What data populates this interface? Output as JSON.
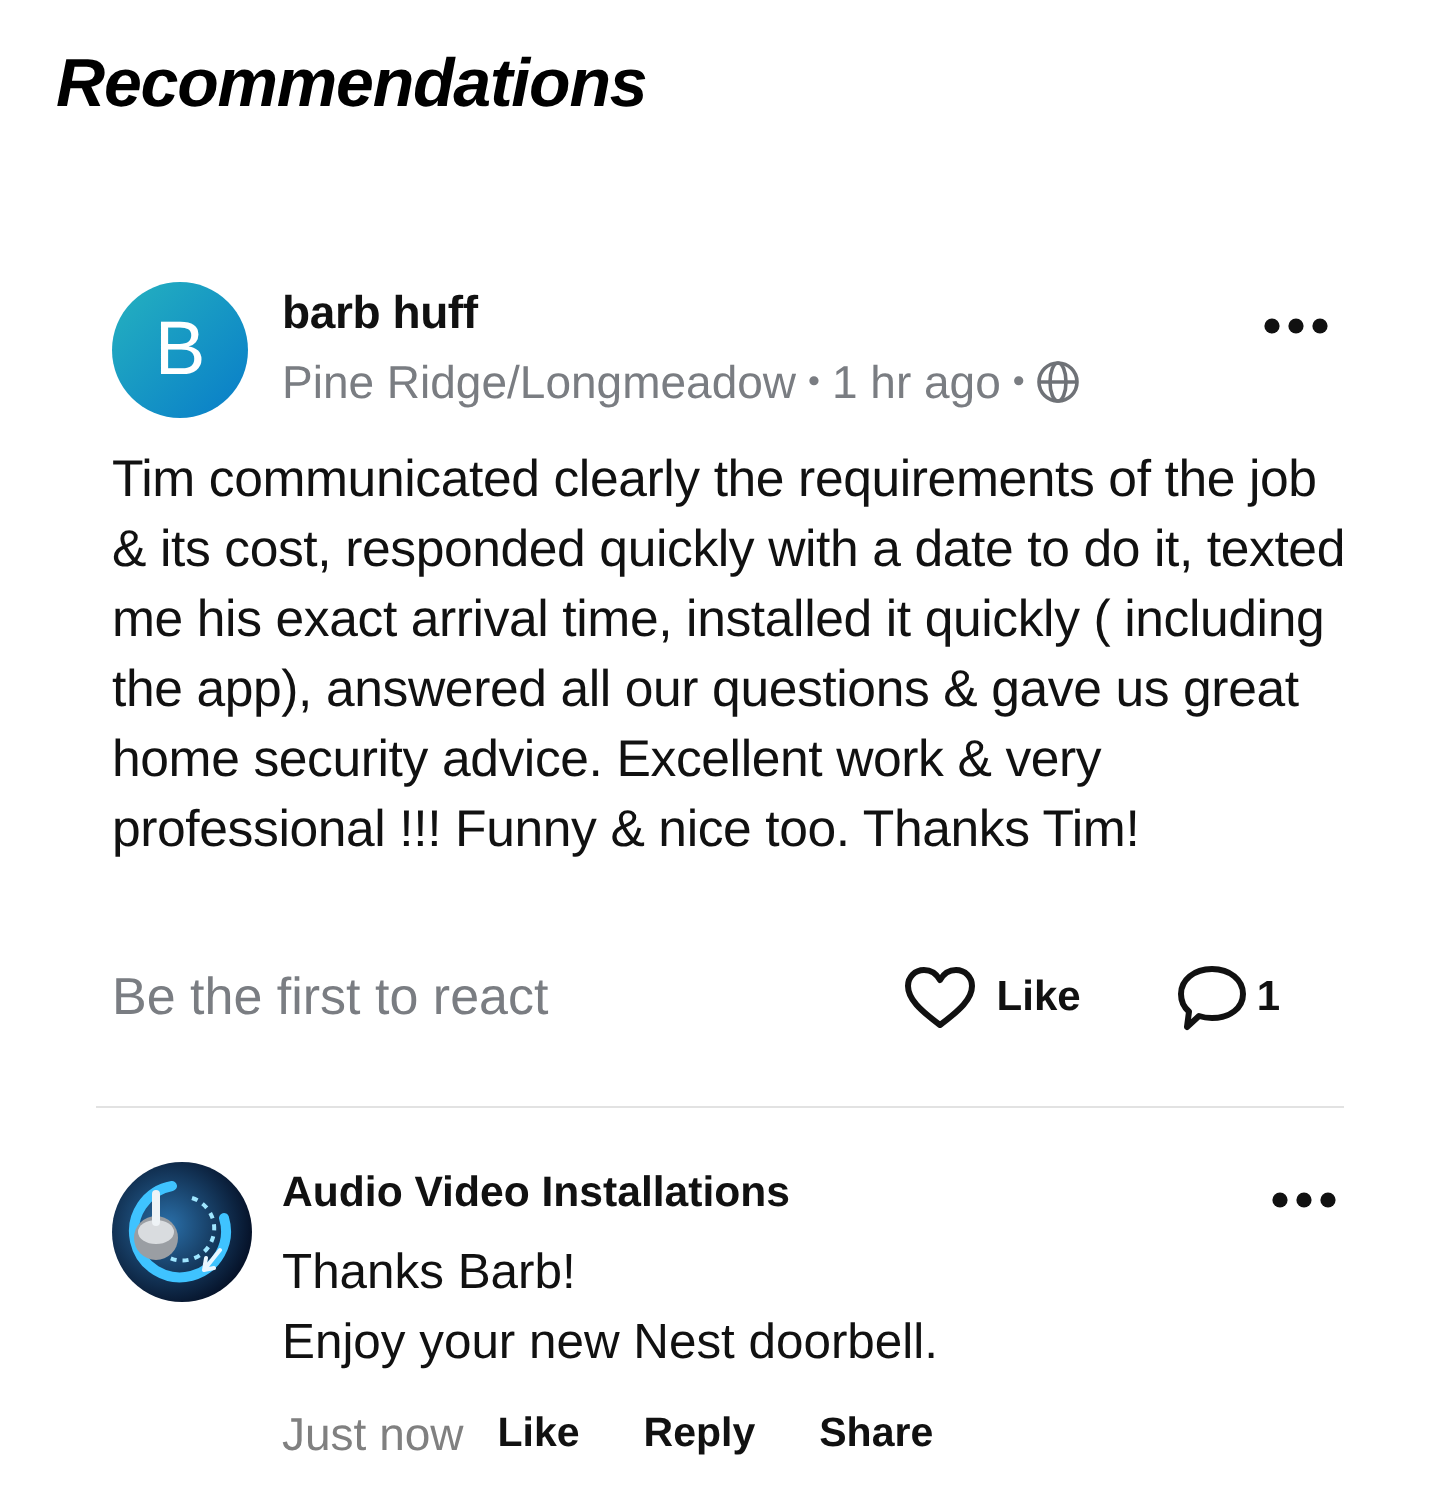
{
  "page": {
    "title": "Recommendations"
  },
  "post": {
    "author": {
      "name": "barb huff",
      "initial": "B"
    },
    "meta": [
      {
        "kind": "text",
        "text": "Pine Ridge/Longmeadow"
      },
      {
        "kind": "separator",
        "text": "•"
      },
      {
        "kind": "text",
        "text": "1 hr ago"
      },
      {
        "kind": "separator",
        "text": "•"
      },
      {
        "kind": "globe"
      }
    ],
    "body": "Tim communicated clearly the requirements of the job & its cost, responded quickly with a date to do it, texted me his exact arrival time, installed it quickly ( including the app), answered all our questions & gave us great home security advice. Excellent work & very professional !!! Funny & nice too. Thanks Tim!",
    "reactions": {
      "prompt": "Be the first to react",
      "like_label": "Like",
      "comment_count": "1"
    }
  },
  "comments": [
    {
      "author": "Audio Video Installations",
      "body": [
        "Thanks Barb!",
        "Enjoy your new Nest doorbell."
      ],
      "time": "Just now",
      "actions": [
        "Like",
        "Reply",
        "Share"
      ]
    }
  ]
}
